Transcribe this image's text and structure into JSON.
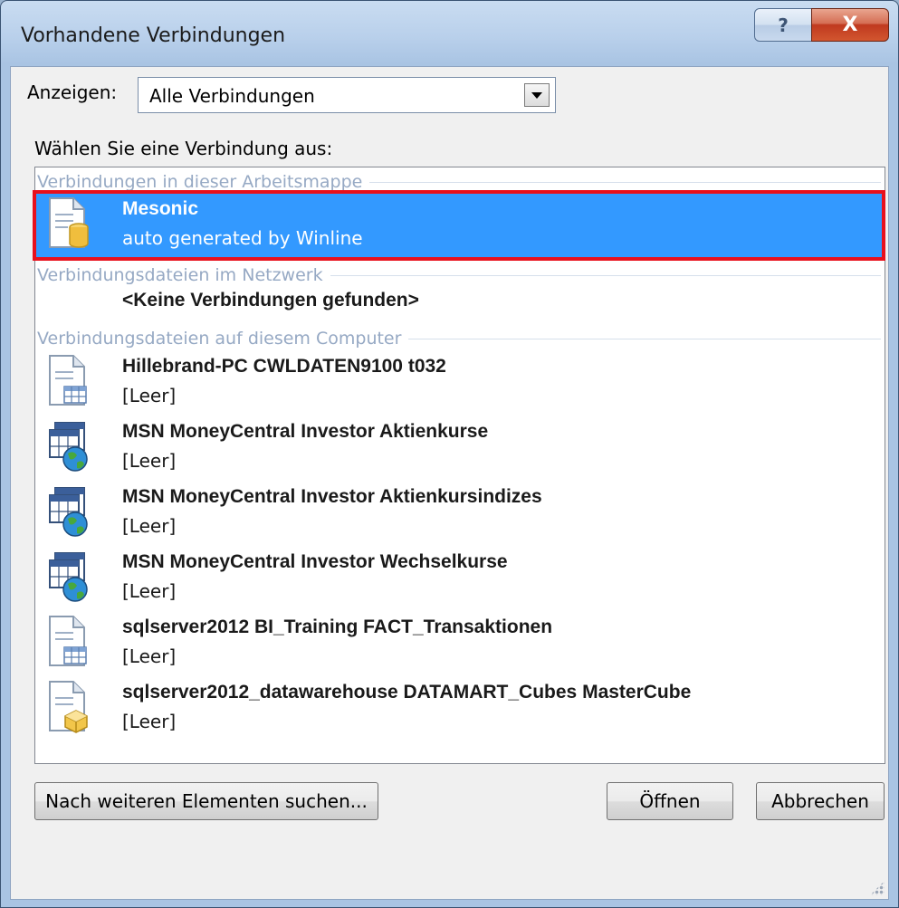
{
  "dialog": {
    "title": "Vorhandene Verbindungen",
    "help_glyph": "?",
    "close_glyph": "X"
  },
  "filter": {
    "label": "Anzeigen:",
    "selected": "Alle Verbindungen"
  },
  "choose_label": "Wählen Sie eine Verbindung aus:",
  "groups": {
    "workbook": "Verbindungen in dieser Arbeitsmappe",
    "network": "Verbindungsdateien im Netzwerk",
    "computer": "Verbindungsdateien auf diesem Computer"
  },
  "workbook_items": [
    {
      "name": "Mesonic",
      "desc": "auto generated by Winline",
      "icon": "database-file-icon"
    }
  ],
  "network_empty": "<Keine Verbindungen gefunden>",
  "computer_items": [
    {
      "name": "Hillebrand-PC CWLDATEN9100 t032",
      "desc": "[Leer]",
      "icon": "table-file-icon"
    },
    {
      "name": "MSN MoneyCentral Investor Aktienkurse",
      "desc": "[Leer]",
      "icon": "web-query-icon"
    },
    {
      "name": "MSN MoneyCentral Investor Aktienkursindizes",
      "desc": "[Leer]",
      "icon": "web-query-icon"
    },
    {
      "name": "MSN MoneyCentral Investor Wechselkurse",
      "desc": "[Leer]",
      "icon": "web-query-icon"
    },
    {
      "name": "sqlserver2012 BI_Training FACT_Transaktionen",
      "desc": "[Leer]",
      "icon": "table-file-icon"
    },
    {
      "name": "sqlserver2012_datawarehouse DATAMART_Cubes MasterCube",
      "desc": "[Leer]",
      "icon": "cube-file-icon"
    }
  ],
  "buttons": {
    "browse": "Nach weiteren Elementen suchen...",
    "open": "Öffnen",
    "cancel": "Abbrechen"
  },
  "colors": {
    "selection": "#3399ff",
    "highlight_frame": "#e8101c"
  }
}
